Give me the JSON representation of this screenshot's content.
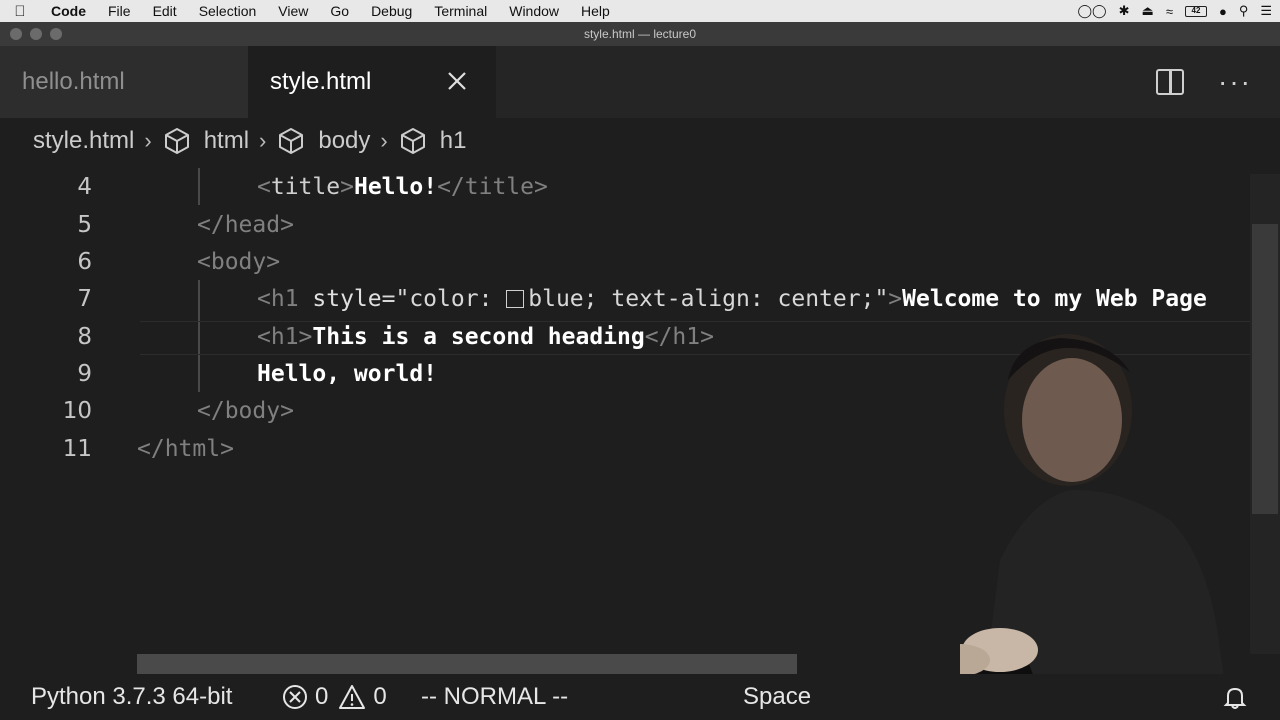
{
  "menubar": {
    "app": "Code",
    "items": [
      "File",
      "Edit",
      "Selection",
      "View",
      "Go",
      "Debug",
      "Terminal",
      "Window",
      "Help"
    ],
    "battery": "42"
  },
  "window": {
    "title": "style.html — lecture0"
  },
  "tabs": [
    {
      "label": "hello.html",
      "active": false
    },
    {
      "label": "style.html",
      "active": true
    }
  ],
  "breadcrumb": {
    "file": "style.html",
    "items": [
      "html",
      "body",
      "h1"
    ]
  },
  "editor": {
    "lines": [
      {
        "n": "4"
      },
      {
        "n": "5"
      },
      {
        "n": "6"
      },
      {
        "n": "7"
      },
      {
        "n": "8"
      },
      {
        "n": "9"
      },
      {
        "n": "10"
      },
      {
        "n": "11"
      }
    ],
    "code": {
      "l4_open": "<",
      "l4_tag": "title",
      "l4_close": ">",
      "l4_text": "Hello!",
      "l4_end": "</title>",
      "l5": "</head>",
      "l6": "<body>",
      "l7_open": "<h1 ",
      "l7_attr": "style",
      "l7_eq": "=\"color: ",
      "l7_blue": "blue; text-align: center;\"",
      "l7_gt": ">",
      "l7_text": "Welcome to my Web Page",
      "l8_open": "<h1>",
      "l8_text": "This is a second heading",
      "l8_close": "</h1>",
      "l9": "Hello, world!",
      "l10": "</body>",
      "l11": "</html>"
    }
  },
  "statusbar": {
    "python": "Python 3.7.3 64-bit",
    "errors": "0",
    "warnings": "0",
    "mode": "-- NORMAL --",
    "spaces": "Space"
  }
}
